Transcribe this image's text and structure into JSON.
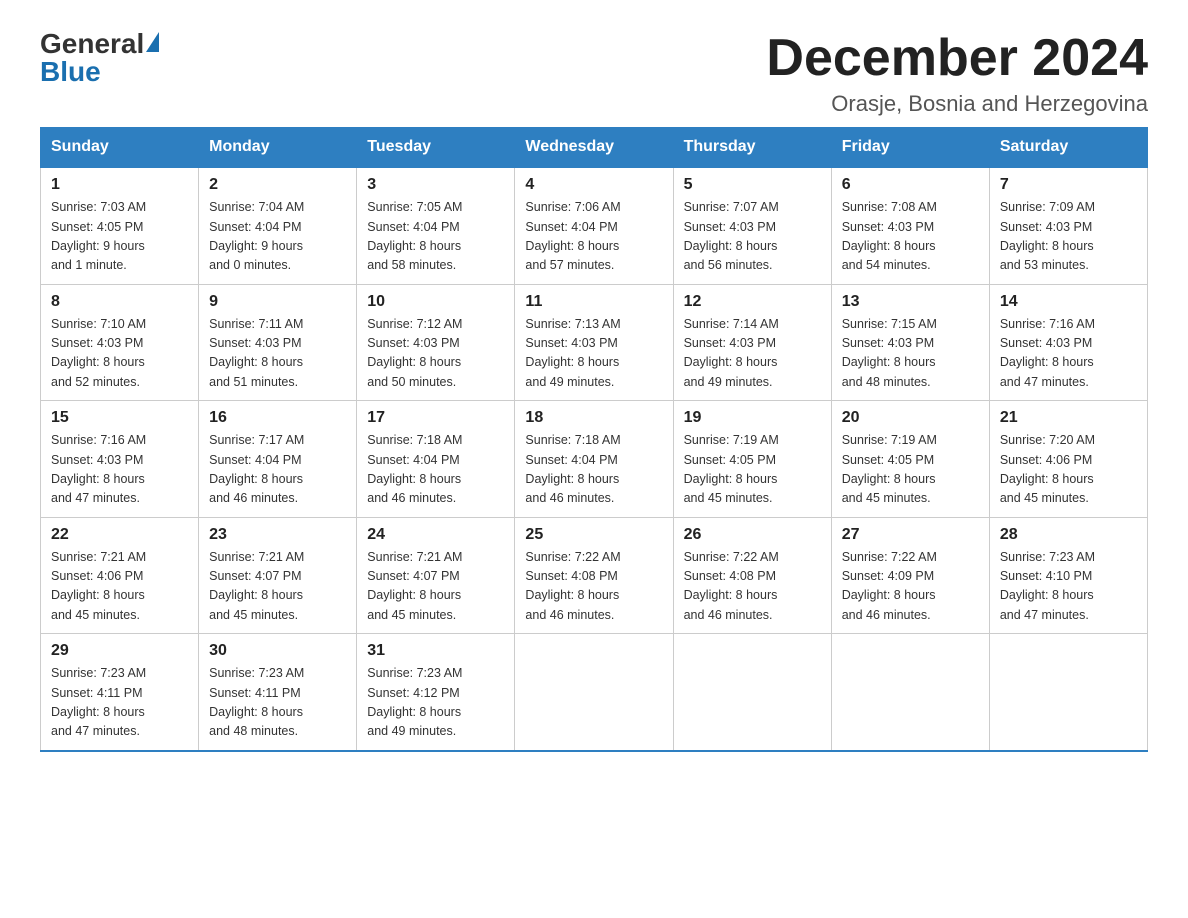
{
  "logo": {
    "general": "General",
    "blue": "Blue"
  },
  "title": "December 2024",
  "subtitle": "Orasje, Bosnia and Herzegovina",
  "days_of_week": [
    "Sunday",
    "Monday",
    "Tuesday",
    "Wednesday",
    "Thursday",
    "Friday",
    "Saturday"
  ],
  "weeks": [
    [
      {
        "day": "1",
        "sunrise": "7:03 AM",
        "sunset": "4:05 PM",
        "daylight": "9 hours and 1 minute."
      },
      {
        "day": "2",
        "sunrise": "7:04 AM",
        "sunset": "4:04 PM",
        "daylight": "9 hours and 0 minutes."
      },
      {
        "day": "3",
        "sunrise": "7:05 AM",
        "sunset": "4:04 PM",
        "daylight": "8 hours and 58 minutes."
      },
      {
        "day": "4",
        "sunrise": "7:06 AM",
        "sunset": "4:04 PM",
        "daylight": "8 hours and 57 minutes."
      },
      {
        "day": "5",
        "sunrise": "7:07 AM",
        "sunset": "4:03 PM",
        "daylight": "8 hours and 56 minutes."
      },
      {
        "day": "6",
        "sunrise": "7:08 AM",
        "sunset": "4:03 PM",
        "daylight": "8 hours and 54 minutes."
      },
      {
        "day": "7",
        "sunrise": "7:09 AM",
        "sunset": "4:03 PM",
        "daylight": "8 hours and 53 minutes."
      }
    ],
    [
      {
        "day": "8",
        "sunrise": "7:10 AM",
        "sunset": "4:03 PM",
        "daylight": "8 hours and 52 minutes."
      },
      {
        "day": "9",
        "sunrise": "7:11 AM",
        "sunset": "4:03 PM",
        "daylight": "8 hours and 51 minutes."
      },
      {
        "day": "10",
        "sunrise": "7:12 AM",
        "sunset": "4:03 PM",
        "daylight": "8 hours and 50 minutes."
      },
      {
        "day": "11",
        "sunrise": "7:13 AM",
        "sunset": "4:03 PM",
        "daylight": "8 hours and 49 minutes."
      },
      {
        "day": "12",
        "sunrise": "7:14 AM",
        "sunset": "4:03 PM",
        "daylight": "8 hours and 49 minutes."
      },
      {
        "day": "13",
        "sunrise": "7:15 AM",
        "sunset": "4:03 PM",
        "daylight": "8 hours and 48 minutes."
      },
      {
        "day": "14",
        "sunrise": "7:16 AM",
        "sunset": "4:03 PM",
        "daylight": "8 hours and 47 minutes."
      }
    ],
    [
      {
        "day": "15",
        "sunrise": "7:16 AM",
        "sunset": "4:03 PM",
        "daylight": "8 hours and 47 minutes."
      },
      {
        "day": "16",
        "sunrise": "7:17 AM",
        "sunset": "4:04 PM",
        "daylight": "8 hours and 46 minutes."
      },
      {
        "day": "17",
        "sunrise": "7:18 AM",
        "sunset": "4:04 PM",
        "daylight": "8 hours and 46 minutes."
      },
      {
        "day": "18",
        "sunrise": "7:18 AM",
        "sunset": "4:04 PM",
        "daylight": "8 hours and 46 minutes."
      },
      {
        "day": "19",
        "sunrise": "7:19 AM",
        "sunset": "4:05 PM",
        "daylight": "8 hours and 45 minutes."
      },
      {
        "day": "20",
        "sunrise": "7:19 AM",
        "sunset": "4:05 PM",
        "daylight": "8 hours and 45 minutes."
      },
      {
        "day": "21",
        "sunrise": "7:20 AM",
        "sunset": "4:06 PM",
        "daylight": "8 hours and 45 minutes."
      }
    ],
    [
      {
        "day": "22",
        "sunrise": "7:21 AM",
        "sunset": "4:06 PM",
        "daylight": "8 hours and 45 minutes."
      },
      {
        "day": "23",
        "sunrise": "7:21 AM",
        "sunset": "4:07 PM",
        "daylight": "8 hours and 45 minutes."
      },
      {
        "day": "24",
        "sunrise": "7:21 AM",
        "sunset": "4:07 PM",
        "daylight": "8 hours and 45 minutes."
      },
      {
        "day": "25",
        "sunrise": "7:22 AM",
        "sunset": "4:08 PM",
        "daylight": "8 hours and 46 minutes."
      },
      {
        "day": "26",
        "sunrise": "7:22 AM",
        "sunset": "4:08 PM",
        "daylight": "8 hours and 46 minutes."
      },
      {
        "day": "27",
        "sunrise": "7:22 AM",
        "sunset": "4:09 PM",
        "daylight": "8 hours and 46 minutes."
      },
      {
        "day": "28",
        "sunrise": "7:23 AM",
        "sunset": "4:10 PM",
        "daylight": "8 hours and 47 minutes."
      }
    ],
    [
      {
        "day": "29",
        "sunrise": "7:23 AM",
        "sunset": "4:11 PM",
        "daylight": "8 hours and 47 minutes."
      },
      {
        "day": "30",
        "sunrise": "7:23 AM",
        "sunset": "4:11 PM",
        "daylight": "8 hours and 48 minutes."
      },
      {
        "day": "31",
        "sunrise": "7:23 AM",
        "sunset": "4:12 PM",
        "daylight": "8 hours and 49 minutes."
      },
      null,
      null,
      null,
      null
    ]
  ],
  "sunrise_label": "Sunrise:",
  "sunset_label": "Sunset:",
  "daylight_label": "Daylight:"
}
